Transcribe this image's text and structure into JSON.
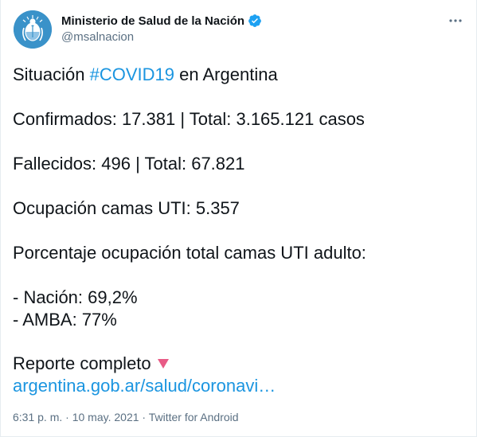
{
  "author": {
    "display_name": "Ministerio de Salud de la Nación",
    "handle": "@msalnacion",
    "verified": true,
    "avatar_icon": "argentina-coat-of-arms-icon",
    "avatar_color": "#3a92c9"
  },
  "tweet": {
    "line1_prefix": "Situación ",
    "hashtag": "#COVID19",
    "line1_suffix": " en Argentina",
    "confirmados": "Confirmados: 17.381 | Total: 3.165.121 casos",
    "fallecidos": "Fallecidos: 496 | Total: 67.821",
    "ocupacion": "Ocupación camas UTI: 5.357",
    "porcentaje": "Porcentaje ocupación total camas UTI adulto:",
    "nacion": "- Nación: 69,2%",
    "amba": "- AMBA: 77%",
    "reporte": "Reporte completo",
    "report_icon": "red-triangle-down-icon",
    "link": "argentina.gob.ar/salud/coronavi…"
  },
  "meta": {
    "time": "6:31 p. m.",
    "separator1": " · ",
    "date": "10 may. 2021",
    "separator2": " · ",
    "client": "Twitter for Android"
  },
  "colors": {
    "link": "#1b95e0",
    "verified_badge": "#1da1f2",
    "secondary_text": "#5b7083",
    "report_icon": "#e0245e"
  }
}
